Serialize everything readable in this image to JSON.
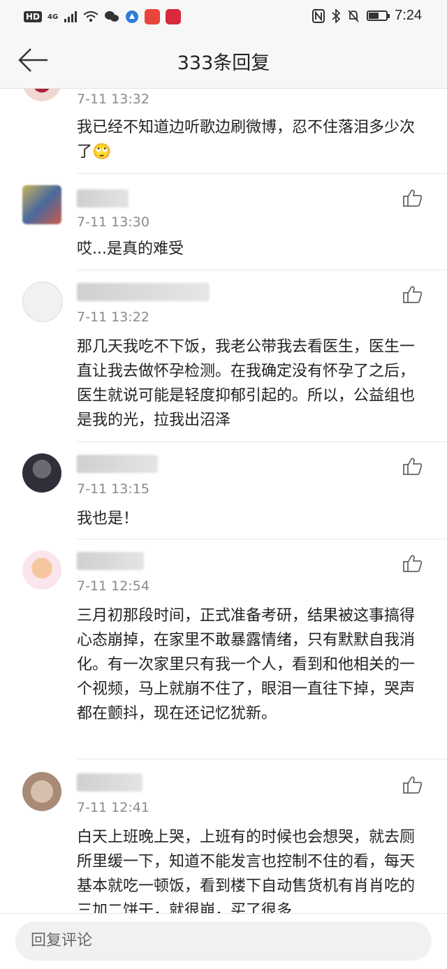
{
  "status_bar": {
    "hd": "HD",
    "network": "4G",
    "time": "7:24",
    "battery_level": 0.6
  },
  "header": {
    "title": "333条回复"
  },
  "comments": [
    {
      "time": "7-11 13:32",
      "text": "我已经不知道边听歌边刷微博，忍不住落泪多少次了🙄",
      "avatar_color": "#c8686a"
    },
    {
      "time": "7-11 13:30",
      "text": "哎...是真的难受",
      "avatar_color": "#7a8a66"
    },
    {
      "time": "7-11 13:22",
      "text": "那几天我吃不下饭，我老公带我去看医生，医生一直让我去做怀孕检测。在我确定没有怀孕了之后，医生就说可能是轻度抑郁引起的。所以，公益组也是我的光，拉我出沼泽",
      "avatar_color": "#d9d9d9"
    },
    {
      "time": "7-11 13:15",
      "text": "我也是！",
      "avatar_color": "#3a3a46"
    },
    {
      "time": "7-11 12:54",
      "text": "三月初那段时间，正式准备考研，结果被这事搞得心态崩掉，在家里不敢暴露情绪，只有默默自我消化。有一次家里只有我一个人，看到和他相关的一个视频，马上就崩不住了，眼泪一直往下掉，哭声都在颤抖，现在还记忆犹新。",
      "avatar_color": "#efc9a6"
    },
    {
      "time": "7-11 12:41",
      "text": "白天上班晚上哭，上班有的时候也会想哭，就去厕所里缓一下，知道不能发言也控制不住的看，每天基本就吃一顿饭，看到楼下自动售货机有肖肖吃的三加二饼干，就很崩，买了很多",
      "avatar_color": "#b89a86"
    }
  ],
  "reply_bar": {
    "placeholder": "回复评论"
  },
  "colors": {
    "bar_bg": "#f7f7f7",
    "time_gray": "#8a8a8a",
    "divider": "#e8e8e8"
  }
}
